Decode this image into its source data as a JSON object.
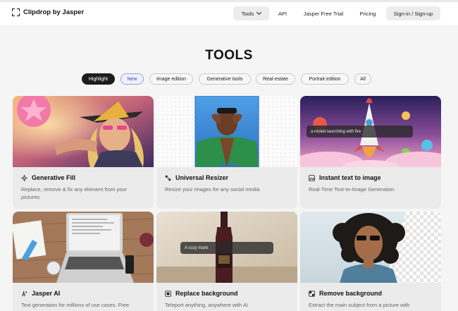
{
  "brand": {
    "name": "Clipdrop by Jasper"
  },
  "nav": {
    "tools": "Tools",
    "api": "API",
    "trial": "Jasper Free Trial",
    "pricing": "Pricing",
    "signin": "Sign-in / Sign-up"
  },
  "page": {
    "title": "TOOLS"
  },
  "filters": [
    {
      "label": "Highlight",
      "selected": true
    },
    {
      "label": "New"
    },
    {
      "label": "Image edition"
    },
    {
      "label": "Generative tools"
    },
    {
      "label": "Real-estate"
    },
    {
      "label": "Portrait edition"
    },
    {
      "label": "All"
    }
  ],
  "cards": [
    {
      "name": "Generative Fill",
      "icon": "sparkle-icon",
      "desc": "Replace, remove & fix any element from your pictures"
    },
    {
      "name": "Universal Resizer",
      "icon": "resize-icon",
      "desc": "Resize your images for any social media"
    },
    {
      "name": "Instant text to image",
      "icon": "text-image-icon",
      "desc": "Real-Time Text-to-Image Generation",
      "prompt": "a rocket launching with fire"
    },
    {
      "name": "Jasper AI",
      "icon": "ai-sparkle-icon",
      "desc": "Text generation for millions of use cases. Free"
    },
    {
      "name": "Replace background",
      "icon": "replace-bg-icon",
      "desc": "Teleport anything, anywhere with AI",
      "prompt": "A cozy marb"
    },
    {
      "name": "Remove background",
      "icon": "remove-bg-icon",
      "desc": "Extract the main subject from a picture with"
    }
  ],
  "colors": {
    "accent": "#1c1c1c",
    "new_chip": "#3b4f9a",
    "card_bg": "#ebebeb"
  }
}
